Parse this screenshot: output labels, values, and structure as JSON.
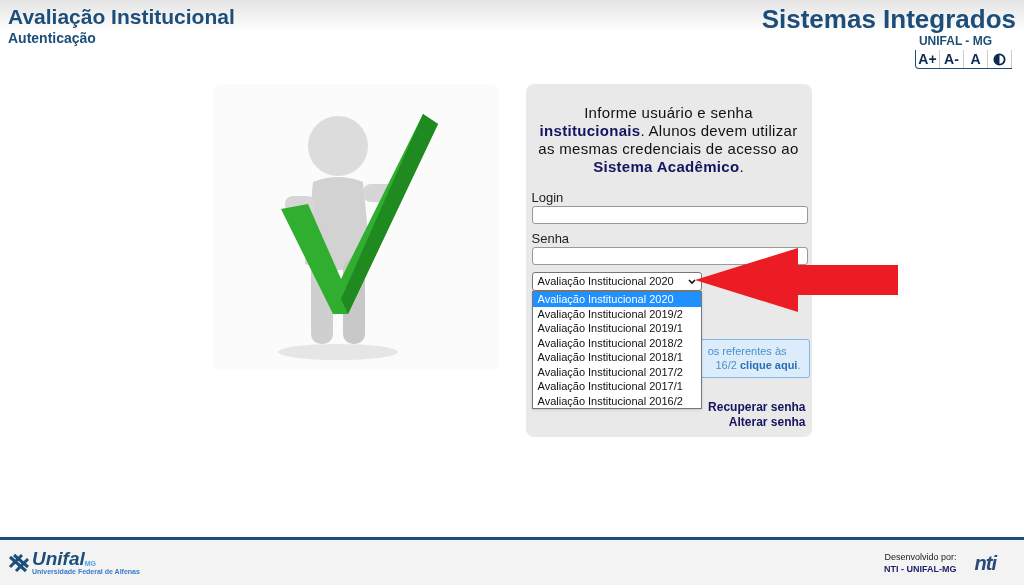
{
  "header": {
    "title": "Avaliação Institucional",
    "subtitle": "Autenticação",
    "system_title": "Sistemas Integrados",
    "system_subtitle": "UNIFAL - MG",
    "font_buttons": [
      {
        "kind": "text",
        "label": "A+"
      },
      {
        "kind": "text",
        "label": "A-"
      },
      {
        "kind": "text",
        "label": "A"
      },
      {
        "kind": "contrast"
      }
    ]
  },
  "login": {
    "instructions": "Informe usuário e senha **institucionais**. Alunos devem utilizar as mesmas credenciais de acesso ao **Sistema Acadêmico**.",
    "login_label": "Login",
    "password_label": "Senha",
    "period_select": {
      "value": "Avaliação Institucional 2020",
      "expanded": true,
      "options": [
        {
          "label": "Avaliação Institucional 2020",
          "selected": true
        },
        {
          "label": "Avaliação Institucional 2019/2",
          "selected": false
        },
        {
          "label": "Avaliação Institucional 2019/1",
          "selected": false
        },
        {
          "label": "Avaliação Institucional 2018/2",
          "selected": false
        },
        {
          "label": "Avaliação Institucional 2018/1",
          "selected": false
        },
        {
          "label": "Avaliação Institucional 2017/2",
          "selected": false
        },
        {
          "label": "Avaliação Institucional 2017/1",
          "selected": false
        },
        {
          "label": "Avaliação Institucional 2016/2",
          "selected": false
        }
      ]
    },
    "notice": {
      "line_1": "os referentes às",
      "line_2_start": "16/2",
      "link": "clique aqui",
      "line_2_end": "."
    },
    "links": [
      "Recuperar senha",
      "Alterar senha"
    ]
  },
  "footer": {
    "logo_text": "Unifal",
    "logo_tag": "MG",
    "logo_caption": "Universidade Federal de Alfenas",
    "developed_by": "Desenvolvido por:",
    "developer": "NTI - UNIFAL-MG",
    "developer_logo": "nti"
  }
}
